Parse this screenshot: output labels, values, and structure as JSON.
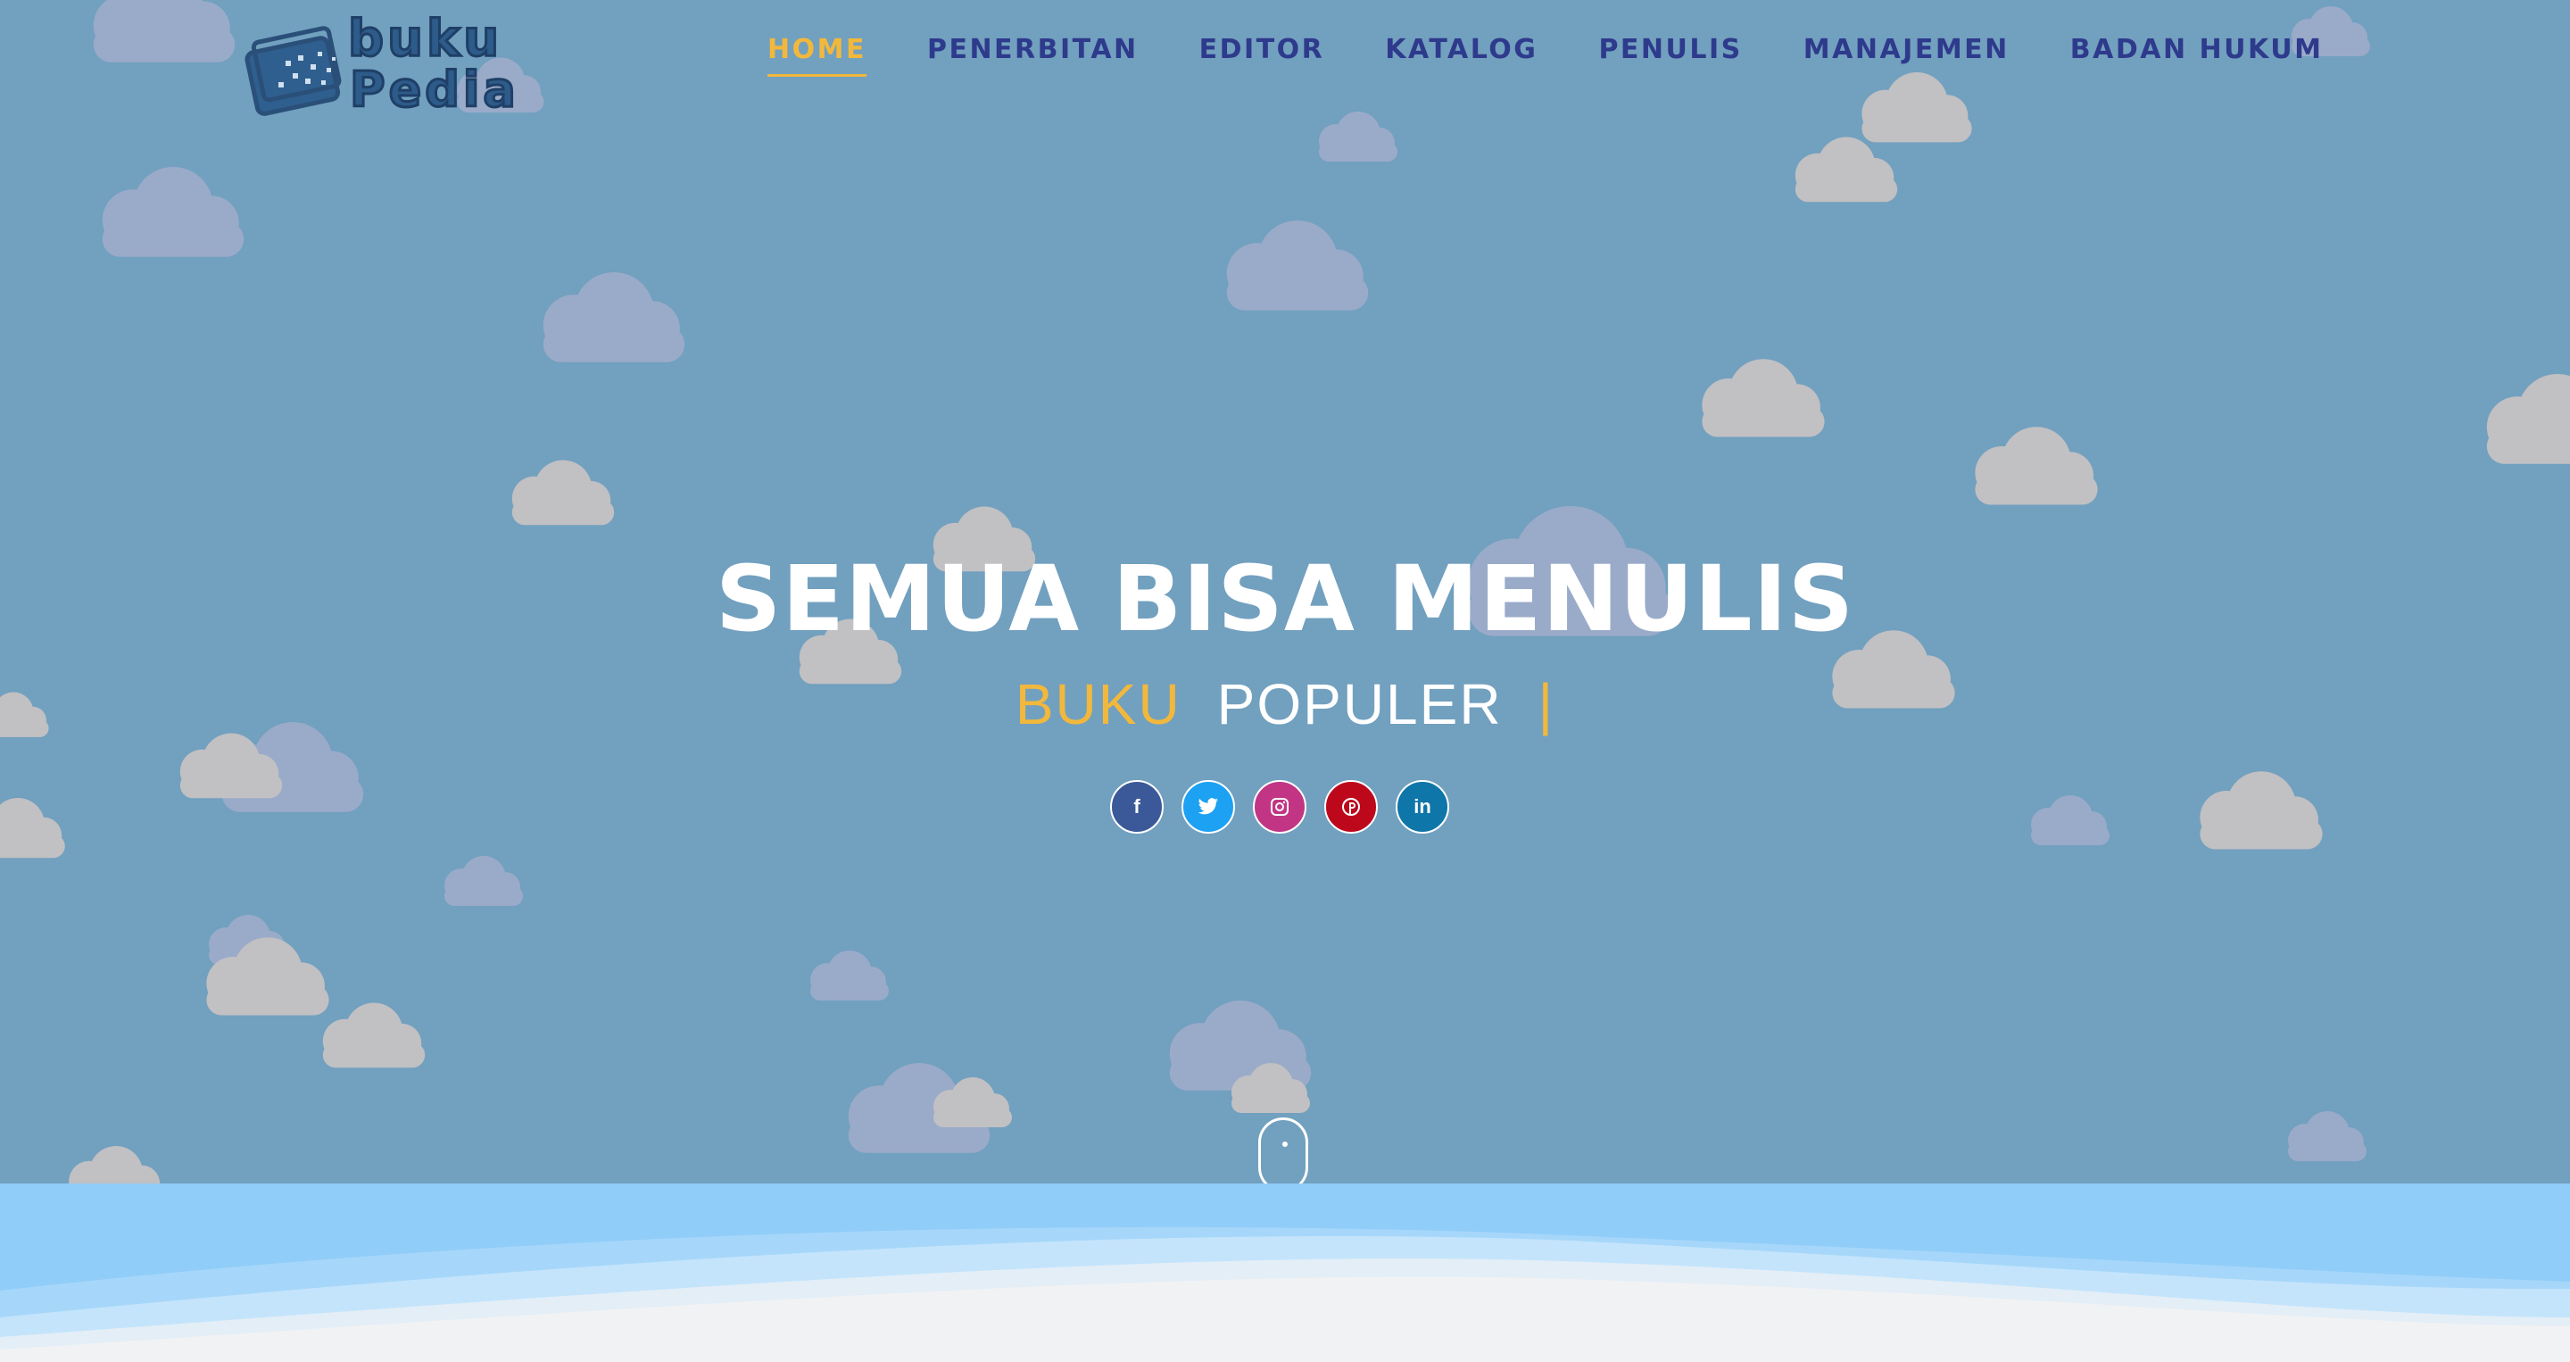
{
  "brand": {
    "logo_text_line1": "buku",
    "logo_text_line2": "Pedia",
    "logo_icon": "book-pixel-logo-icon"
  },
  "nav": {
    "items": [
      {
        "label": "HOME",
        "active": true
      },
      {
        "label": "PENERBITAN",
        "active": false
      },
      {
        "label": "EDITOR",
        "active": false
      },
      {
        "label": "KATALOG",
        "active": false
      },
      {
        "label": "PENULIS",
        "active": false
      },
      {
        "label": "MANAJEMEN",
        "active": false
      },
      {
        "label": "BADAN HUKUM",
        "active": false
      }
    ]
  },
  "hero": {
    "title": "SEMUA BISA MENULIS",
    "subtitle_accent": "BUKU",
    "subtitle_main": "POPULER",
    "subtitle_cursor": "|"
  },
  "social": [
    {
      "name": "facebook-icon",
      "glyph": "f",
      "color": "#3b5998"
    },
    {
      "name": "twitter-icon",
      "glyph": "t",
      "color": "#1da1f2"
    },
    {
      "name": "instagram-icon",
      "glyph": "◎",
      "color": "#c13584"
    },
    {
      "name": "pinterest-icon",
      "glyph": "p",
      "color": "#bd081c"
    },
    {
      "name": "linkedin-icon",
      "glyph": "in",
      "color": "#0e76a8"
    }
  ],
  "colors": {
    "background": "#72a0bf",
    "nav_text": "#2e3a8c",
    "accent": "#f2b83c",
    "wave_light": "#90cdf8",
    "footer_bg": "#f1f2f4"
  }
}
